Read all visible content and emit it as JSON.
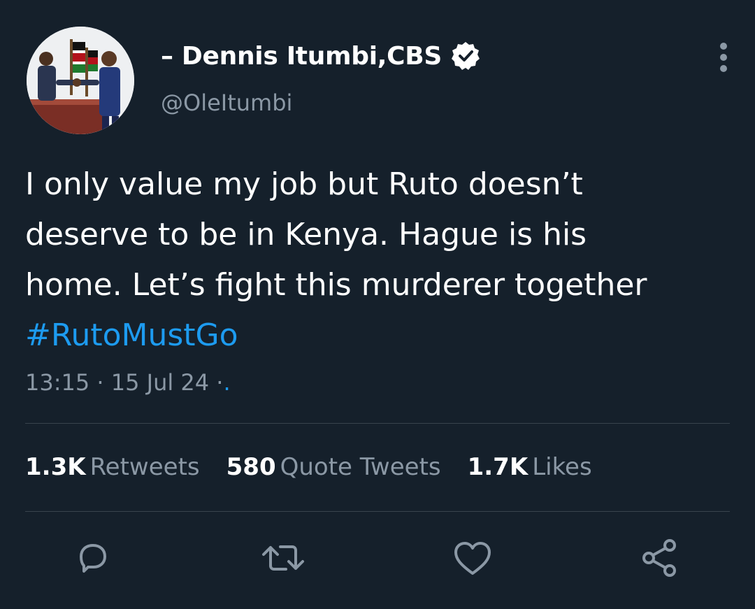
{
  "author": {
    "display_name": "– Dennis Itumbi,CBS",
    "handle": "@OleItumbi",
    "verified": true
  },
  "tweet": {
    "lines": [
      "I only value my job but Ruto doesn’t",
      "deserve to be in Kenya. Hague is his",
      "home. Let’s fight this murderer together"
    ],
    "hashtag": "#RutoMustGo",
    "time": "13:15",
    "date": "15 Jul 24",
    "sep": "·",
    "source_link": "."
  },
  "stats": {
    "retweets": {
      "count": "1.3K",
      "label": "Retweets"
    },
    "quotes": {
      "count": "580",
      "label": "Quote Tweets"
    },
    "likes": {
      "count": "1.7K",
      "label": "Likes"
    }
  },
  "actions": {
    "reply": "reply-icon",
    "retweet": "retweet-icon",
    "like": "heart-icon",
    "share": "share-icon"
  },
  "colors": {
    "background": "#15202b",
    "accent": "#1d9bf0",
    "muted": "#8b98a5",
    "divider": "#38444d"
  }
}
